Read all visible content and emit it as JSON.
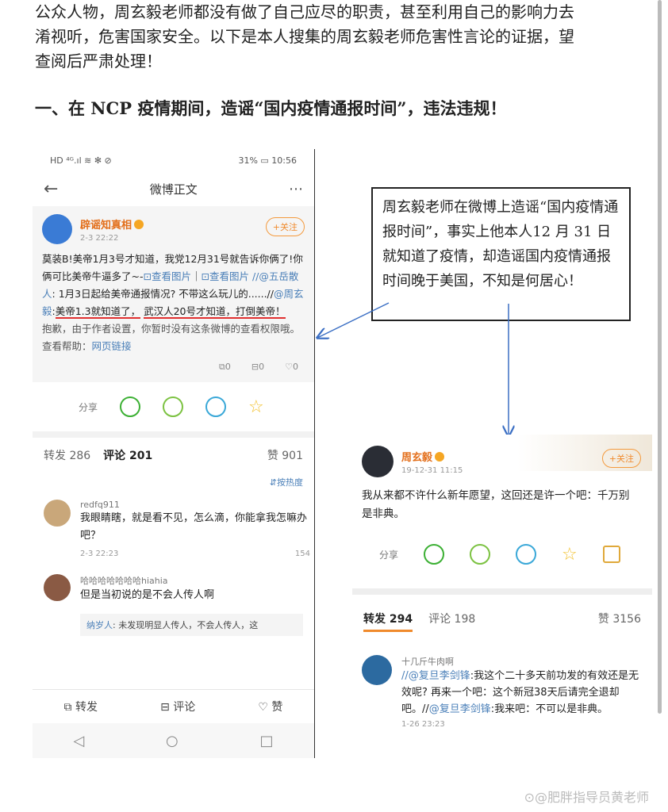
{
  "doc": {
    "lines": [
      "公众人物，周玄毅老师都没有做了自己应尽的职责，甚至利用自己的影响力去",
      "淆视听，危害国家安全。以下是本人搜集的周玄毅老师危害性言论的证据，望",
      "查阅后严肃处理！"
    ],
    "heading": "一、在 NCP 疫情期间，造谣“国内疫情通报时间”，违法违规！"
  },
  "left_phone": {
    "status_left": "HD ⁴ᴳ.ıl ≋ ✻ ⊘",
    "status_right": "31% ▭ 10:56",
    "nav_title": "微博正文",
    "back_icon": "back-arrow-icon",
    "more_icon": "more-dots-icon",
    "post": {
      "user": "辟谣知真相",
      "time": "2-3 22:22",
      "follow": "+关注",
      "text1": "莫装B!美帝1月3号才知道，我党12月31号就告诉你俩了!你俩可比美帝牛逼多了~-",
      "link1": "⊡查看图片",
      "sep": "｜",
      "link2": "⊡查看图片",
      "slash1": "//",
      "mention1": "@五岳散人",
      "text2": ": 1月3日起给美帝通报情况? 不带这么玩儿的......//",
      "mention2": "@周玄毅",
      "colon": ":",
      "highlight1": "美帝1.3就知道了，",
      "highlight2": "武汉人20号才知道，打倒美帝！",
      "notice": "抱歉，由于作者设置，你暂时没有这条微博的查看权限哦。查看帮助：",
      "notice_link": "网页链接",
      "stat_repost": "⧉0",
      "stat_comment": "⊟0",
      "stat_like": "♡0"
    },
    "share_label": "分享",
    "tabs": {
      "repost": "转发 286",
      "comments": "评论 201",
      "likes": "赞 901"
    },
    "sort": "⇵按热度",
    "comments": [
      {
        "name": "redfq911",
        "text": "我眼睛瞎，就是看不见，怎么滴，你能拿我怎嘛办吧？",
        "time": "2-3 22:23",
        "likes": "154"
      },
      {
        "name": "哈哈哈哈哈哈哈hiahia",
        "text": "但是当初说的是不会人传人啊",
        "reply_name": "纳岁人",
        "reply_text": ": 未发现明显人传人，不会人传人，这"
      }
    ],
    "bottom": {
      "repost": "⧉ 转发",
      "comment": "⊟ 评论",
      "like": "♡ 赞"
    },
    "sys": {
      "back": "◁",
      "home": "○",
      "recent": "□"
    }
  },
  "annotation": "周玄毅老师在微博上造谣“国内疫情通报时间”，事实上他本人12 月 31 日就知道了疫情，却造谣国内疫情通报时间晚于美国，不知是何居心！",
  "right_post": {
    "user": "周玄毅",
    "time": "19-12-31 11:15",
    "follow": "+关注",
    "text": "我从来都不许什么新年愿望，这回还是许一个吧：千万别是非典。",
    "share_label": "分享",
    "tabs": {
      "repost": "转发 294",
      "comments": "评论 198",
      "likes": "赞 3156"
    },
    "comment": {
      "name": "十几斤牛肉啊",
      "slash": "//",
      "mention": "@复旦李剑锋",
      "text_a": ":我这个二十多天前功发的有效还是无效呢? 再来一个吧：这个新冠38天后请完全退却吧。//",
      "mention2": "@复旦李剑锋",
      "text_b": ":我来吧：不可以是非典。",
      "time": "1-26 23:23"
    }
  },
  "watermark": "⊙@肥胖指导员黄老师",
  "colors": {
    "orange": "#f08a2c",
    "link": "#4a7fb8",
    "red": "#e03030",
    "arrow": "#3b6fc4"
  }
}
